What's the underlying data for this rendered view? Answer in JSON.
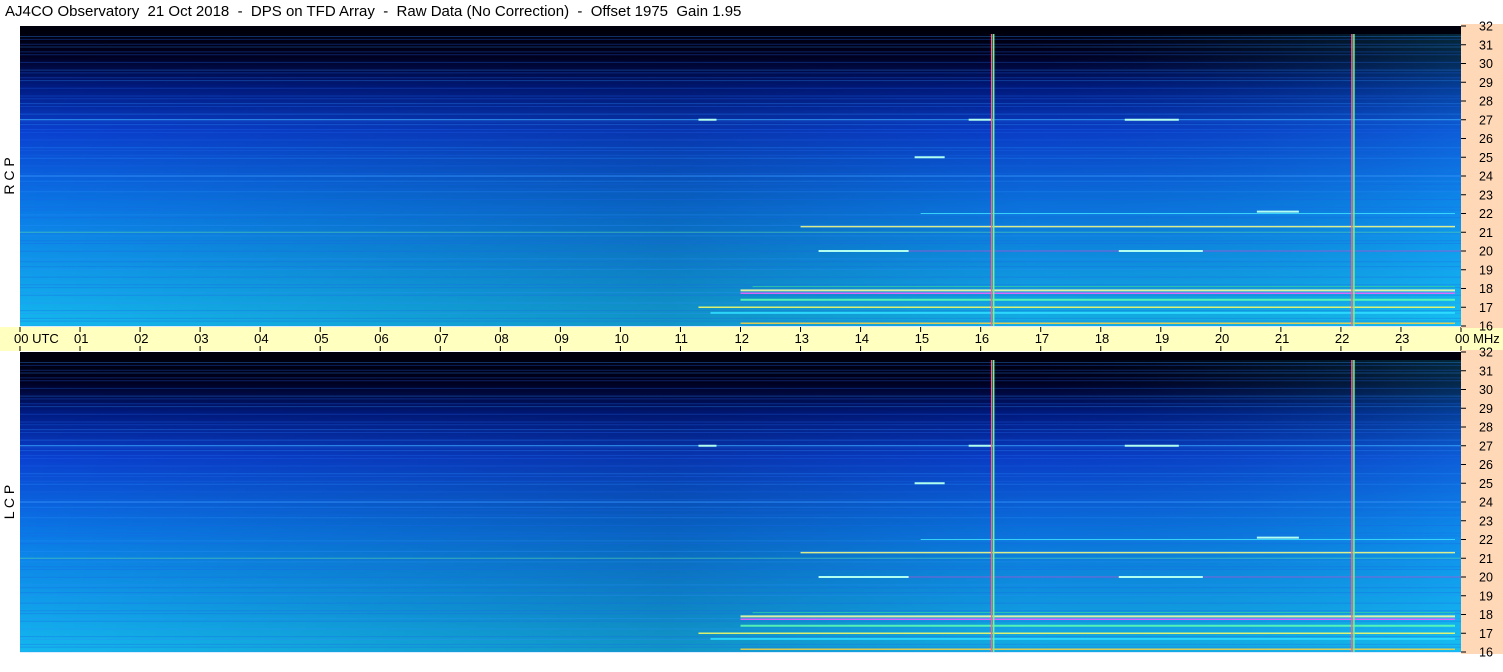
{
  "title": "AJ4CO Observatory  21 Oct 2018  -  DPS on TFD Array  -  Raw Data (No Correction)  -  Offset 1975  Gain 1.95",
  "chart_data": {
    "type": "heatmap",
    "x_unit": "UTC",
    "y_unit": "MHz",
    "x_ticks": [
      "00",
      "01",
      "02",
      "03",
      "04",
      "05",
      "06",
      "07",
      "08",
      "09",
      "10",
      "11",
      "12",
      "13",
      "14",
      "15",
      "16",
      "17",
      "18",
      "19",
      "20",
      "21",
      "22",
      "23",
      "00"
    ],
    "y_ticks": [
      "16",
      "17",
      "18",
      "19",
      "20",
      "21",
      "22",
      "23",
      "24",
      "25",
      "26",
      "27",
      "28",
      "29",
      "30",
      "31",
      "32"
    ],
    "xlim": [
      0,
      24
    ],
    "ylim": [
      16,
      32
    ],
    "panels": [
      {
        "name": "R C P"
      },
      {
        "name": "L C P"
      }
    ],
    "vertical_markers_utc": [
      16.2,
      22.2
    ],
    "colors": {
      "axis_band": "#ffffc0",
      "right_strip": "#ffd8b8",
      "low": "#000018",
      "mid": "#0a3cd8",
      "high": "#10d0f0",
      "hot": "#ff60ff"
    }
  }
}
